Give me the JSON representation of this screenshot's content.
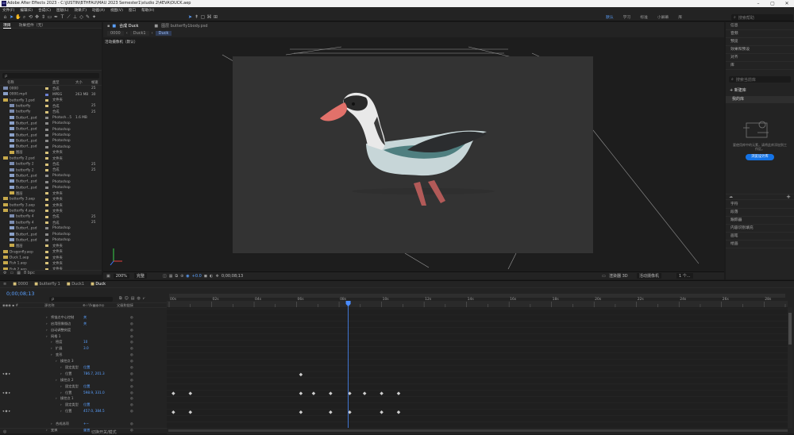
{
  "window": {
    "title": "Adobe After Effects 2023 - C:\\JUSTIN\\BTHFAU\\MAU 2023 Semester1\\studio 2\\4EVA\\DUCK.aep"
  },
  "menu": [
    "文件(F)",
    "编辑(E)",
    "合成(C)",
    "图层(L)",
    "效果(T)",
    "动画(A)",
    "视图(V)",
    "窗口",
    "帮助(H)"
  ],
  "workspaces": [
    "默认",
    "学习",
    "标准",
    "小屏幕",
    "库"
  ],
  "search_help": {
    "placeholder": "搜索帮助"
  },
  "project_panel": {
    "tabs": [
      "项目",
      "效果控件（无）"
    ],
    "search_placeholder": "ρ",
    "columns": [
      "名称",
      "类型",
      "大小",
      "帧速"
    ],
    "items": [
      {
        "name": "0000",
        "type": "合成",
        "size": "",
        "fps": "25",
        "indent": 0,
        "icon": "comp",
        "label": "#d8c27a"
      },
      {
        "name": "0000.mp4",
        "type": "MPEG",
        "size": "263 MB",
        "fps": "30",
        "indent": 0,
        "icon": "footage",
        "label": "#6a7fd1"
      },
      {
        "name": "butterfly 1.psd",
        "type": "文件夹",
        "size": "",
        "fps": "",
        "indent": 0,
        "icon": "folder",
        "label": "#d8c27a"
      },
      {
        "name": "butterfly",
        "type": "合成",
        "size": "",
        "fps": "25",
        "indent": 1,
        "icon": "comp",
        "label": "#d8c27a"
      },
      {
        "name": "butterfly",
        "type": "合成",
        "size": "",
        "fps": "25",
        "indent": 1,
        "icon": "comp",
        "label": "#d8c27a"
      },
      {
        "name": "Butterf...psd",
        "type": "Photosh...5",
        "size": "1.6 MB",
        "fps": "",
        "indent": 1,
        "icon": "footage",
        "label": "#8a8a8a"
      },
      {
        "name": "Butterf...psd",
        "type": "Photoshop",
        "size": "",
        "fps": "",
        "indent": 1,
        "icon": "footage",
        "label": "#8a8a8a"
      },
      {
        "name": "Butterf...psd",
        "type": "Photoshop",
        "size": "",
        "fps": "",
        "indent": 1,
        "icon": "footage",
        "label": "#8a8a8a"
      },
      {
        "name": "Butterf...psd",
        "type": "Photoshop",
        "size": "",
        "fps": "",
        "indent": 1,
        "icon": "footage",
        "label": "#8a8a8a"
      },
      {
        "name": "Butterf...psd",
        "type": "Photoshop",
        "size": "",
        "fps": "",
        "indent": 1,
        "icon": "footage",
        "label": "#8a8a8a"
      },
      {
        "name": "Butterf...psd",
        "type": "Photoshop",
        "size": "",
        "fps": "",
        "indent": 1,
        "icon": "footage",
        "label": "#8a8a8a"
      },
      {
        "name": "图层",
        "type": "文件夹",
        "size": "",
        "fps": "",
        "indent": 1,
        "icon": "folder",
        "label": "#d8c27a"
      },
      {
        "name": "butterfly 2.psd",
        "type": "文件夹",
        "size": "",
        "fps": "",
        "indent": 0,
        "icon": "folder",
        "label": "#d8c27a"
      },
      {
        "name": "butterfly 2",
        "type": "合成",
        "size": "",
        "fps": "25",
        "indent": 1,
        "icon": "comp",
        "label": "#d8c27a"
      },
      {
        "name": "butterfly 2",
        "type": "合成",
        "size": "",
        "fps": "25",
        "indent": 1,
        "icon": "comp",
        "label": "#d8c27a"
      },
      {
        "name": "Butterf...psd",
        "type": "Photoshop",
        "size": "",
        "fps": "",
        "indent": 1,
        "icon": "footage",
        "label": "#8a8a8a"
      },
      {
        "name": "Butterf...psd",
        "type": "Photoshop",
        "size": "",
        "fps": "",
        "indent": 1,
        "icon": "footage",
        "label": "#8a8a8a"
      },
      {
        "name": "Butterf...psd",
        "type": "Photoshop",
        "size": "",
        "fps": "",
        "indent": 1,
        "icon": "footage",
        "label": "#8a8a8a"
      },
      {
        "name": "图层",
        "type": "文件夹",
        "size": "",
        "fps": "",
        "indent": 1,
        "icon": "folder",
        "label": "#d8c27a"
      },
      {
        "name": "butterfly 3.aep",
        "type": "文件夹",
        "size": "",
        "fps": "",
        "indent": 0,
        "icon": "folder",
        "label": "#d8c27a"
      },
      {
        "name": "butterfly 3.aep",
        "type": "文件夹",
        "size": "",
        "fps": "",
        "indent": 0,
        "icon": "folder",
        "label": "#d8c27a"
      },
      {
        "name": "butterfly 4.aep",
        "type": "文件夹",
        "size": "",
        "fps": "",
        "indent": 0,
        "icon": "folder",
        "label": "#d8c27a"
      },
      {
        "name": "butterfly 4",
        "type": "合成",
        "size": "",
        "fps": "25",
        "indent": 1,
        "icon": "comp",
        "label": "#d8c27a"
      },
      {
        "name": "butterfly 4",
        "type": "合成",
        "size": "",
        "fps": "25",
        "indent": 1,
        "icon": "comp",
        "label": "#d8c27a"
      },
      {
        "name": "Butterf...psd",
        "type": "Photoshop",
        "size": "",
        "fps": "",
        "indent": 1,
        "icon": "footage",
        "label": "#8a8a8a"
      },
      {
        "name": "Butterf...psd",
        "type": "Photoshop",
        "size": "",
        "fps": "",
        "indent": 1,
        "icon": "footage",
        "label": "#8a8a8a"
      },
      {
        "name": "Butterf...psd",
        "type": "Photoshop",
        "size": "",
        "fps": "",
        "indent": 1,
        "icon": "footage",
        "label": "#8a8a8a"
      },
      {
        "name": "图层",
        "type": "文件夹",
        "size": "",
        "fps": "",
        "indent": 1,
        "icon": "folder",
        "label": "#d8c27a"
      },
      {
        "name": "Dragonfly.aep",
        "type": "文件夹",
        "size": "",
        "fps": "",
        "indent": 0,
        "icon": "folder",
        "label": "#d8c27a"
      },
      {
        "name": "Duck 1.aep",
        "type": "文件夹",
        "size": "",
        "fps": "",
        "indent": 0,
        "icon": "folder",
        "label": "#d8c27a"
      },
      {
        "name": "Fish 1.aep",
        "type": "文件夹",
        "size": "",
        "fps": "",
        "indent": 0,
        "icon": "folder",
        "label": "#d8c27a"
      },
      {
        "name": "Fish 2.aep",
        "type": "文件夹",
        "size": "",
        "fps": "",
        "indent": 0,
        "icon": "folder",
        "label": "#d8c27a"
      }
    ],
    "footer": {
      "depth": "8 bpc"
    }
  },
  "composition_panel": {
    "tab_label": "合成 Duck",
    "layer_tab": "图层 butterfly1body.psd",
    "breadcrumbs": [
      "0000",
      "Duck1",
      "Duck"
    ],
    "camera_label": "活动摄像机（默认）",
    "zoom": "200%",
    "quality": "完整",
    "timecode": "0;00;08;13",
    "exposure": "+0.0",
    "renderer": "渲染器 3D",
    "camera": "活动摄像机",
    "views": "1 个..."
  },
  "right_panel": {
    "sections": [
      "信息",
      "音频",
      "预览",
      "效果和预设",
      "对齐",
      "库"
    ],
    "library_search_placeholder": "搜索当前库",
    "new_library": "+ 新建库",
    "my_library": "我的库",
    "empty_message": "要使用库中的元素，请将此库添加到工作区。",
    "browse_button": "浏览设计库",
    "lower_sections": [
      "字符",
      "段落",
      "跟踪器",
      "内容识别填充",
      "画笔",
      "绘画"
    ]
  },
  "timeline": {
    "tabs": [
      "0000",
      "butterfly 1",
      "Duck1",
      "Duck"
    ],
    "timecode": "0;00;08;13",
    "search_placeholder": "ρ",
    "columns": {
      "source": "源名称",
      "mode": "模式",
      "parent": "父级和链接"
    },
    "ruler_labels": [
      "00s",
      "02s",
      "04s",
      "06s",
      "08s",
      "10s",
      "12s",
      "14s",
      "16s",
      "18s",
      "20s",
      "22s",
      "24s",
      "26s",
      "28s"
    ],
    "playhead_time": 8.43,
    "duration": 29,
    "rows": [
      {
        "label": "",
        "value": "",
        "indent": 0
      },
      {
        "label": "将锚点中心控制",
        "value": "关",
        "indent": 1
      },
      {
        "label": "启用图像描边",
        "value": "关",
        "indent": 1
      },
      {
        "label": "自动调整刻度",
        "value": "",
        "indent": 1
      },
      {
        "label": "网格 1",
        "value": "",
        "indent": 1
      },
      {
        "label": "密度",
        "value": "10",
        "indent": 2
      },
      {
        "label": "扩展",
        "value": "3.0",
        "indent": 2
      },
      {
        "label": "变形",
        "value": "",
        "indent": 2
      },
      {
        "label": "操控点 3",
        "value": "",
        "indent": 3
      },
      {
        "label": "固定类型",
        "value": "位置",
        "indent": 4
      },
      {
        "label": "位置",
        "value": "786.7, 201.3",
        "indent": 4
      },
      {
        "label": "操控点 2",
        "value": "",
        "indent": 3
      },
      {
        "label": "固定类型",
        "value": "位置",
        "indent": 4
      },
      {
        "label": "位置",
        "value": "598.9, 331.0",
        "indent": 4
      },
      {
        "label": "操控点 1",
        "value": "",
        "indent": 3
      },
      {
        "label": "固定类型",
        "value": "位置",
        "indent": 4
      },
      {
        "label": "位置",
        "value": "457.0, 384.5",
        "indent": 4
      },
      {
        "label": "",
        "value": "",
        "indent": 3
      },
      {
        "label": "合成选项",
        "value": "+−",
        "indent": 2
      },
      {
        "label": "变换",
        "value": "重置",
        "indent": 1
      }
    ],
    "keyframes": [
      {
        "row": 10,
        "times": [
          6.2
        ]
      },
      {
        "row": 13,
        "times": [
          0.2,
          1.0,
          6.2,
          6.8,
          7.6,
          8.5,
          9.2,
          10.0,
          10.8
        ]
      },
      {
        "row": 16,
        "times": [
          0.2,
          1.0,
          6.2,
          7.6,
          8.5,
          10.0,
          10.8
        ]
      }
    ],
    "footer": {
      "toggle_label": "切换开关/模式"
    }
  }
}
